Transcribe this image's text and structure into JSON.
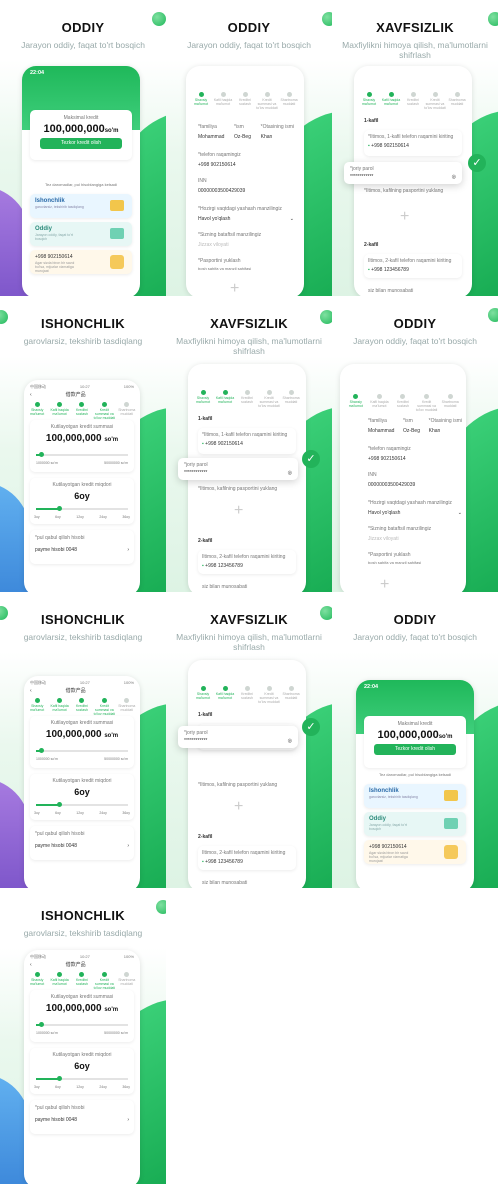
{
  "tiles": {
    "oddiy": {
      "title": "ODDIY",
      "subtitle": "Jarayon oddiy, faqat to'rt bosqich"
    },
    "xavfsizlik": {
      "title": "XAVFSIZLIK",
      "subtitle": "Maxfiylikni himoya qilish, ma'lumotlarni shifrlash"
    },
    "ishonchlik": {
      "title": "ISHONCHLIK",
      "subtitle": "garovlarsiz, tekshirib tasdiqlang"
    }
  },
  "home": {
    "time": "22:04",
    "max_label": "Maksimal kredit",
    "amount": "100,000,000",
    "unit": "so'm",
    "apply_button": "Tezkor kredit olish",
    "note": "Tez daromadlar, pul hisoblangiga kelsadi",
    "features": [
      {
        "title": "Ishonchlik",
        "desc": "garovlarsiz, tekshirib tasdiqlang"
      },
      {
        "title": "Oddiy",
        "desc": "Jarayon oddiy, faqat to'rt bosqich"
      },
      {
        "title": "+998 902150614",
        "desc": "Agar sizda biron bir savol bo'lsa, mijozlar xizmatiga murojaat"
      }
    ]
  },
  "steps": [
    "Shaxsiy ma'lumot",
    "Kafil haqida ma'lumot",
    "Kreditni sozlash",
    "Kredit summasi va to'lov muddati",
    "Shartnoma muddati"
  ],
  "form": {
    "surname_label": "*familiya",
    "surname": "Mohammad",
    "name_label": "*ism",
    "name": "Oz-Beg",
    "patronymic_label": "*Otasining ismi",
    "patronymic": "Khan",
    "phone_label": "*telefon raqamingiz",
    "phone": "+998 902150614",
    "inn_label": "INN",
    "inn": "00000003500429039",
    "marital_label": "*Hozirgi vaqtdagi yashash manzilingiz",
    "marital": "Havol yo'qlash",
    "workplace_label": "*Sizning bataftsil manzilingiz",
    "workplace_placeholder": "Jizzax viloyati",
    "passport_label": "*Pasportini yuklash",
    "passport_hint": "bosh sahifa va manzil sahifasi"
  },
  "guarantor": {
    "first": "1-kafil",
    "first_phone_label": "*Iltimos, 1-kafil telefon raqamini kiriting",
    "first_phone": "+998 902150614",
    "password_label": "*joriy parol",
    "password": "************",
    "passport_prompt": "*Iltimos, kafilning pasportini yuklang",
    "second": "2-kafil",
    "second_phone_label": "Iltimos, 2-kafil telefon raqamini kiriting",
    "second_phone": "+998 123456789",
    "relation": "siz bilan munosabati"
  },
  "loan": {
    "status_left": "中国移动 ",
    "status_time": "10:27",
    "status_right": "100%",
    "header": "借款产品",
    "sum_label": "Kutilayotgan kredit summasi",
    "amount": "100,000,000",
    "unit": "so'm",
    "min": "1000000 so'm",
    "max": "50000000 so'm",
    "amount_fraction": 0.05,
    "term_label": "Kutilayotgan kredit miqdori",
    "term": "6oy",
    "term_ticks": [
      "3oy",
      "6oy",
      "12oy",
      "24oy",
      "36oy"
    ],
    "term_fraction": 0.25,
    "account_label": "*pul qabul qilish hisobi",
    "account": "payme hisobi 0048"
  }
}
